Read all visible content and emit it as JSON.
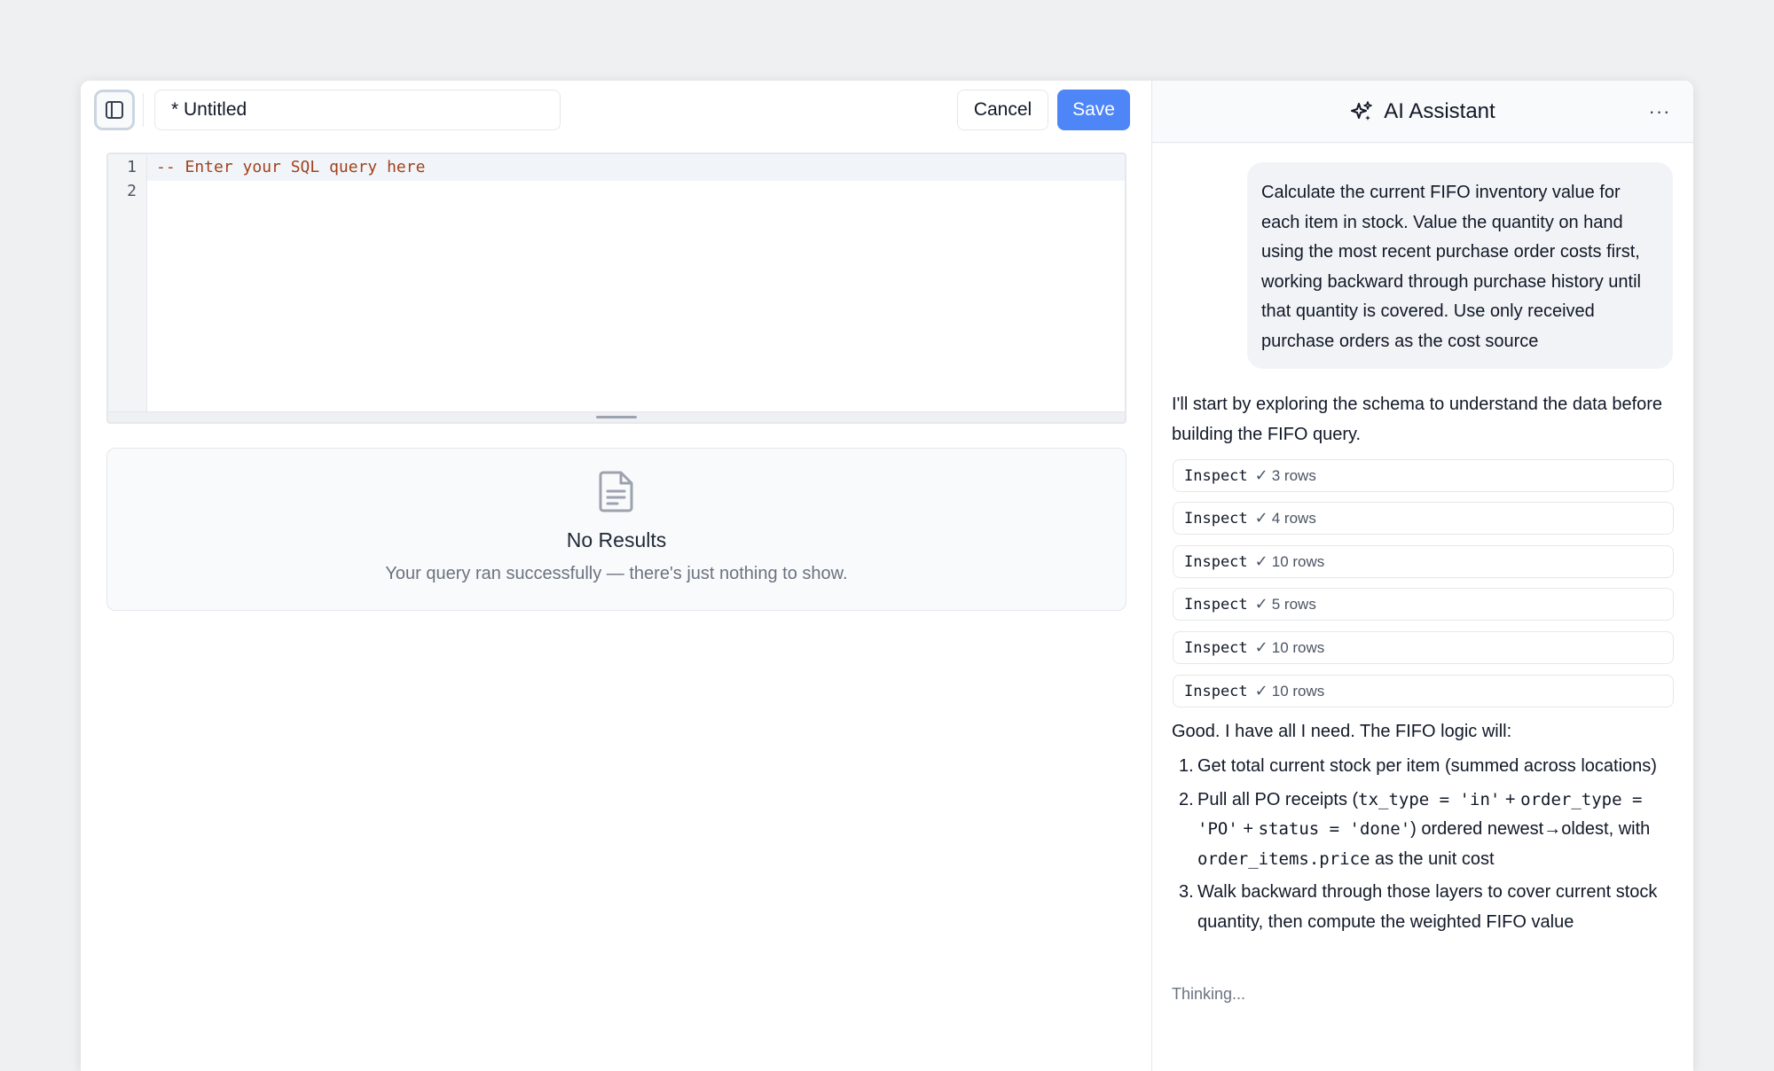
{
  "editor": {
    "title_value": "* Untitled",
    "cancel_label": "Cancel",
    "save_label": "Save",
    "line_numbers": [
      "1",
      "2"
    ],
    "code_line_1": "-- Enter your SQL query here",
    "code_line_2": ""
  },
  "results": {
    "icon": "document-icon",
    "title": "No Results",
    "subtitle": "Your query ran successfully — there's just nothing to show."
  },
  "assistant": {
    "title": "AI Assistant",
    "icon": "sparkles-icon",
    "more_label": "···",
    "user_message": "Calculate the current FIFO inventory value for each item in stock. Value the quantity on hand using the most recent purchase order costs first, working backward through purchase history until that quantity is covered. Use only received purchase orders as the cost source",
    "intro": "I'll start by exploring the schema to understand the data before building the FIFO query.",
    "tool_calls": [
      {
        "name": "Inspect",
        "check": "✓",
        "result": "3 rows"
      },
      {
        "name": "Inspect",
        "check": "✓",
        "result": "4 rows"
      },
      {
        "name": "Inspect",
        "check": "✓",
        "result": "10 rows"
      },
      {
        "name": "Inspect",
        "check": "✓",
        "result": "5 rows"
      },
      {
        "name": "Inspect",
        "check": "✓",
        "result": "10 rows"
      },
      {
        "name": "Inspect",
        "check": "✓",
        "result": "10 rows"
      }
    ],
    "plan_intro": "Good. I have all I need. The FIFO logic will:",
    "plan": {
      "step1_num": "1.",
      "step1_text": "Get total current stock per item (summed across locations)",
      "step2_num": "2.",
      "step2_a": "Pull all PO receipts (",
      "step2_code1": "tx_type = 'in'",
      "step2_b": " + ",
      "step2_code2": "order_type = 'PO'",
      "step2_c": " + ",
      "step2_code3": "status = 'done'",
      "step2_d": ") ordered newest→oldest, with ",
      "step2_code4": "order_items.price",
      "step2_e": " as the unit cost",
      "step3_num": "3.",
      "step3_text": "Walk backward through those layers to cover current stock quantity, then compute the weighted FIFO value"
    },
    "status": "Thinking..."
  },
  "colors": {
    "accent": "#4f86f7",
    "comment": "#a0421d",
    "background": "#eff0f2"
  }
}
